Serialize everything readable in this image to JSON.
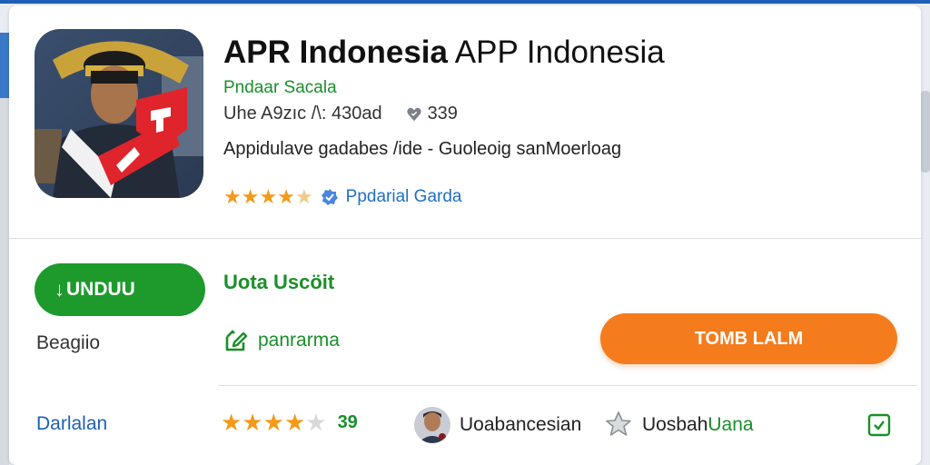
{
  "app": {
    "title_bold": "APR Indonesia",
    "title_normal": "APP Indonesia",
    "developer": "Pndaar Sacala",
    "meta_left": "Uhe A9zıc /\\: 430ad",
    "meta_count": "339",
    "description": "Appidulave gadabes /ide - Guoleoig sanMoerloag",
    "editor_label": "Ppdarial Garda",
    "rating_stars": 4
  },
  "actions": {
    "download_label": "UNDUU",
    "secondary_label": "Beagiio",
    "section_title": "Uota Uscöit",
    "link_label": "panrarma",
    "primary_button": "TOMB LALM"
  },
  "footer": {
    "link_label": "Darlalan",
    "rating_stars": 4,
    "rating_count": "39",
    "user_name": "Uoabancesian",
    "favorite_dark": "Uosbah",
    "favorite_green": "Uana"
  },
  "colors": {
    "brand_green": "#1e9a2c",
    "accent_orange": "#f57c1c",
    "link_blue": "#1f5fb8",
    "star_orange": "#f39a1a"
  },
  "icons": [
    "heart-icon",
    "verified-icon",
    "download-arrow-icon",
    "edit-icon",
    "star-outline-icon",
    "checkbox-icon"
  ]
}
